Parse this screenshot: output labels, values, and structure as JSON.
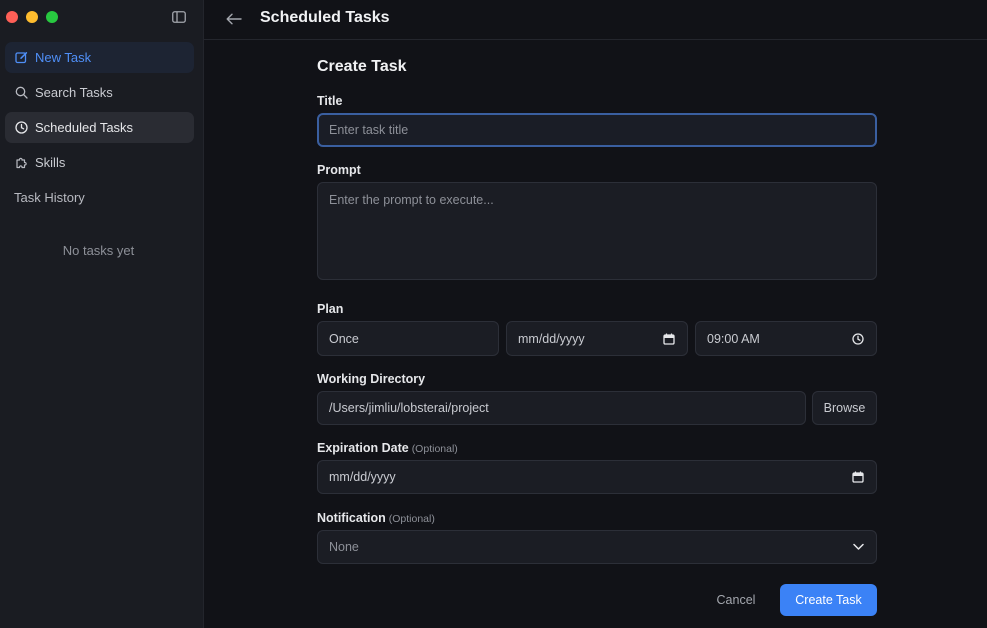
{
  "sidebar": {
    "items": [
      {
        "label": "New Task",
        "icon": "edit-icon"
      },
      {
        "label": "Search Tasks",
        "icon": "search-icon"
      },
      {
        "label": "Scheduled Tasks",
        "icon": "clock-icon"
      },
      {
        "label": "Skills",
        "icon": "puzzle-icon"
      }
    ],
    "history_title": "Task History",
    "empty_text": "No tasks yet"
  },
  "header": {
    "title": "Scheduled Tasks"
  },
  "form": {
    "heading": "Create Task",
    "title_label": "Title",
    "title_placeholder": "Enter task title",
    "prompt_label": "Prompt",
    "prompt_placeholder": "Enter the prompt to execute...",
    "plan_label": "Plan",
    "plan_frequency": "Once",
    "plan_date": "mm/dd/yyyy",
    "plan_time": "09:00 AM",
    "directory_label": "Working Directory",
    "directory_value": "/Users/jimliu/lobsterai/project",
    "browse_label": "Browse",
    "expiration_label": "Expiration Date",
    "expiration_optional": "(Optional)",
    "expiration_value": "mm/dd/yyyy",
    "notification_label": "Notification",
    "notification_optional": "(Optional)",
    "notification_value": "None",
    "cancel_label": "Cancel",
    "submit_label": "Create Task"
  },
  "colors": {
    "accent": "#3b82f6",
    "background": "#111217",
    "sidebar": "#1a1c22"
  }
}
